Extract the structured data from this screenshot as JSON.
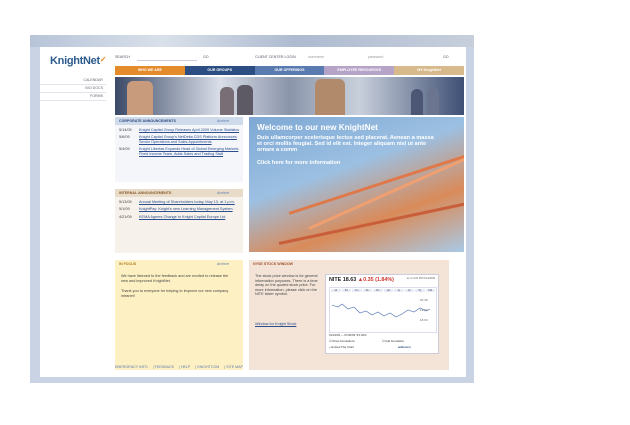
{
  "logo": {
    "text": "KnightNet"
  },
  "topbar": {
    "search_label": "SEARCH",
    "go1": "GO",
    "client_label": "CLIENT CENTER LOGIN",
    "username_ph": "username",
    "password_ph": "password",
    "go2": "GO"
  },
  "nav": {
    "items": [
      "WHO WE ARE",
      "OUR GROUPS",
      "OUR OFFERINGS",
      "EMPLOYEE RESOURCES",
      "MY KnightNet"
    ],
    "colors": [
      "#e48b2c",
      "#2d4e82",
      "#5a7bb0",
      "#b5a3c8",
      "#d7b98b"
    ]
  },
  "sidebar": {
    "items": [
      "CALENDAR",
      "BIO DOCS",
      "FORMS"
    ]
  },
  "corporate": {
    "title": "CORPORATE ANNOUNCEMENTS",
    "archive": "Archive",
    "items": [
      {
        "date": "5/14/09",
        "text": "Knight Capital Group Releases April 2009 Volume Statistics"
      },
      {
        "date": "5/6/09",
        "text": "Knight Capital Group's NetDelta CDS Platform Announces Senior Operations and Sales Appointments"
      },
      {
        "date": "5/4/09",
        "text": "Knight Libertas Expands Head of Global Emerging Markets Fixed Income Team, Adds Sales and Trading Staff"
      }
    ]
  },
  "internal": {
    "title": "INTERNAL ANNOUNCEMENTS",
    "archive": "Archive",
    "items": [
      {
        "date": "5/13/09",
        "text": "Annual Meeting of Shareholders today, May 13, at 1 p.m."
      },
      {
        "date": "5/1/09",
        "text": "KnightPay: Knight's new Learning Management System"
      },
      {
        "date": "4/21/09",
        "text": "KEMA Agrees Change to Knight Capital Europe Ltd"
      }
    ]
  },
  "welcome": {
    "title": "Welcome to our new KnightNet",
    "body": "Duis ullamcorper scelerisque lectus sed placerat. Aenean a massa et orci mollis feugiat. Sed id elit est. Integer aliquam nisl ut ante ornare a comm",
    "link": "Click here for more information"
  },
  "focus": {
    "title": "IN FOCUS",
    "archive": "Archive",
    "p1": "We have listened to the feedback and are excited to release the new and improved KnightNet.",
    "p2": "Thank you to everyone for helping to improve our new company intranet!"
  },
  "nse": {
    "title": "NYSE STOCK WINDOW",
    "text": "The stock price window is for general information purposes. There is a time delay on the quoted stock price. For more information, please click on the NITE ticker symbol.",
    "link": "Window for Knight Stock"
  },
  "stock": {
    "symbol": "NITE",
    "price": "18.63",
    "change": "▲0.35 (1.84%)",
    "meta": "as of 4:02 PM\n5/14/2009",
    "tabs": [
      "1d",
      "5d",
      "1m",
      "3m",
      "6m",
      "ytd",
      "1y",
      "2y",
      "5y",
      "Full"
    ],
    "axis": [
      "20.48",
      "19.50",
      "18.63"
    ],
    "months": [
      "Feb 2009",
      "Mar",
      "Apr",
      "May"
    ],
    "range_text": "01/23/09 — 07/30/09 ▼0.62%",
    "cb1": "Show Annotations",
    "cb2": "Add Annotation",
    "embed": "Embed This Chart",
    "brand": "wikinvest"
  },
  "footer": {
    "items": [
      "EMERGENCY INFO",
      "FEEDBACK",
      "HELP",
      "KNIGHTCOM",
      "SITE MAP"
    ]
  }
}
